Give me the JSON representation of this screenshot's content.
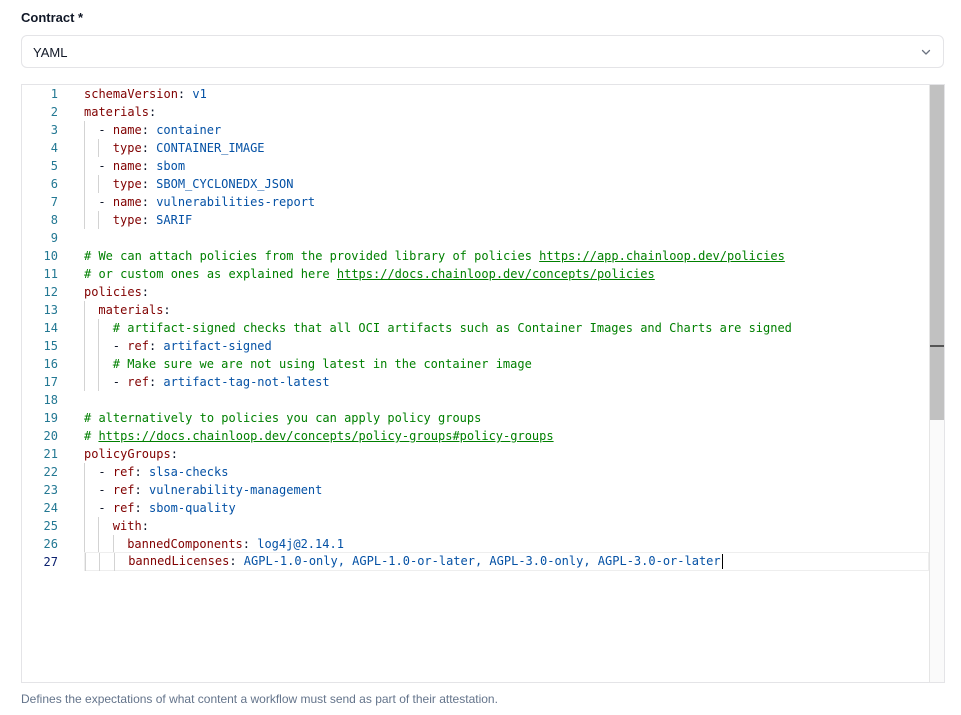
{
  "field": {
    "label": "Contract *",
    "selected": "YAML",
    "help": "Defines the expectations of what content a workflow must send as part of their attestation."
  },
  "editor": {
    "language": "yaml",
    "active_line": 27,
    "lines": [
      {
        "n": "1",
        "indent": 0,
        "tokens": [
          {
            "t": "schemaVersion",
            "c": "k"
          },
          {
            "t": ": ",
            "c": "p"
          },
          {
            "t": "v1",
            "c": "s"
          }
        ]
      },
      {
        "n": "2",
        "indent": 0,
        "tokens": [
          {
            "t": "materials",
            "c": "k"
          },
          {
            "t": ":",
            "c": "p"
          }
        ]
      },
      {
        "n": "3",
        "indent": 1,
        "tokens": [
          {
            "t": "- ",
            "c": "p"
          },
          {
            "t": "name",
            "c": "k"
          },
          {
            "t": ": ",
            "c": "p"
          },
          {
            "t": "container",
            "c": "s"
          }
        ]
      },
      {
        "n": "4",
        "indent": 2,
        "tokens": [
          {
            "t": "type",
            "c": "k"
          },
          {
            "t": ": ",
            "c": "p"
          },
          {
            "t": "CONTAINER_IMAGE",
            "c": "s"
          }
        ]
      },
      {
        "n": "5",
        "indent": 1,
        "tokens": [
          {
            "t": "- ",
            "c": "p"
          },
          {
            "t": "name",
            "c": "k"
          },
          {
            "t": ": ",
            "c": "p"
          },
          {
            "t": "sbom",
            "c": "s"
          }
        ]
      },
      {
        "n": "6",
        "indent": 2,
        "tokens": [
          {
            "t": "type",
            "c": "k"
          },
          {
            "t": ": ",
            "c": "p"
          },
          {
            "t": "SBOM_CYCLONEDX_JSON",
            "c": "s"
          }
        ]
      },
      {
        "n": "7",
        "indent": 1,
        "tokens": [
          {
            "t": "- ",
            "c": "p"
          },
          {
            "t": "name",
            "c": "k"
          },
          {
            "t": ": ",
            "c": "p"
          },
          {
            "t": "vulnerabilities-report",
            "c": "s"
          }
        ]
      },
      {
        "n": "8",
        "indent": 2,
        "tokens": [
          {
            "t": "type",
            "c": "k"
          },
          {
            "t": ": ",
            "c": "p"
          },
          {
            "t": "SARIF",
            "c": "s"
          }
        ]
      },
      {
        "n": "9",
        "indent": 0,
        "tokens": []
      },
      {
        "n": "10",
        "indent": 0,
        "tokens": [
          {
            "t": "# We can attach policies from the provided library of policies ",
            "c": "c"
          },
          {
            "t": "https://app.chainloop.dev/policies",
            "c": "u"
          }
        ]
      },
      {
        "n": "11",
        "indent": 0,
        "tokens": [
          {
            "t": "# or custom ones as explained here ",
            "c": "c"
          },
          {
            "t": "https://docs.chainloop.dev/concepts/policies",
            "c": "u"
          }
        ]
      },
      {
        "n": "12",
        "indent": 0,
        "tokens": [
          {
            "t": "policies",
            "c": "k"
          },
          {
            "t": ":",
            "c": "p"
          }
        ]
      },
      {
        "n": "13",
        "indent": 1,
        "tokens": [
          {
            "t": "materials",
            "c": "k"
          },
          {
            "t": ":",
            "c": "p"
          }
        ]
      },
      {
        "n": "14",
        "indent": 2,
        "tokens": [
          {
            "t": "# artifact-signed checks that all OCI artifacts such as Container Images and Charts are signed",
            "c": "c"
          }
        ]
      },
      {
        "n": "15",
        "indent": 2,
        "tokens": [
          {
            "t": "- ",
            "c": "p"
          },
          {
            "t": "ref",
            "c": "k"
          },
          {
            "t": ": ",
            "c": "p"
          },
          {
            "t": "artifact-signed",
            "c": "s"
          }
        ]
      },
      {
        "n": "16",
        "indent": 2,
        "tokens": [
          {
            "t": "# Make sure we are not using latest in the container image",
            "c": "c"
          }
        ]
      },
      {
        "n": "17",
        "indent": 2,
        "tokens": [
          {
            "t": "- ",
            "c": "p"
          },
          {
            "t": "ref",
            "c": "k"
          },
          {
            "t": ": ",
            "c": "p"
          },
          {
            "t": "artifact-tag-not-latest",
            "c": "s"
          }
        ]
      },
      {
        "n": "18",
        "indent": 0,
        "tokens": []
      },
      {
        "n": "19",
        "indent": 0,
        "tokens": [
          {
            "t": "# alternatively to policies you can apply policy groups",
            "c": "c"
          }
        ]
      },
      {
        "n": "20",
        "indent": 0,
        "tokens": [
          {
            "t": "# ",
            "c": "c"
          },
          {
            "t": "https://docs.chainloop.dev/concepts/policy-groups#policy-groups",
            "c": "u"
          }
        ]
      },
      {
        "n": "21",
        "indent": 0,
        "tokens": [
          {
            "t": "policyGroups",
            "c": "k"
          },
          {
            "t": ":",
            "c": "p"
          }
        ]
      },
      {
        "n": "22",
        "indent": 1,
        "tokens": [
          {
            "t": "- ",
            "c": "p"
          },
          {
            "t": "ref",
            "c": "k"
          },
          {
            "t": ": ",
            "c": "p"
          },
          {
            "t": "slsa-checks",
            "c": "s"
          }
        ]
      },
      {
        "n": "23",
        "indent": 1,
        "tokens": [
          {
            "t": "- ",
            "c": "p"
          },
          {
            "t": "ref",
            "c": "k"
          },
          {
            "t": ": ",
            "c": "p"
          },
          {
            "t": "vulnerability-management",
            "c": "s"
          }
        ]
      },
      {
        "n": "24",
        "indent": 1,
        "tokens": [
          {
            "t": "- ",
            "c": "p"
          },
          {
            "t": "ref",
            "c": "k"
          },
          {
            "t": ": ",
            "c": "p"
          },
          {
            "t": "sbom-quality",
            "c": "s"
          }
        ]
      },
      {
        "n": "25",
        "indent": 2,
        "tokens": [
          {
            "t": "with",
            "c": "k"
          },
          {
            "t": ":",
            "c": "p"
          }
        ]
      },
      {
        "n": "26",
        "indent": 3,
        "tokens": [
          {
            "t": "bannedComponents",
            "c": "k"
          },
          {
            "t": ": ",
            "c": "p"
          },
          {
            "t": "log4j@2.14.1",
            "c": "s"
          }
        ]
      },
      {
        "n": "27",
        "indent": 3,
        "tokens": [
          {
            "t": "bannedLicenses",
            "c": "k"
          },
          {
            "t": ": ",
            "c": "p"
          },
          {
            "t": "AGPL-1.0-only, AGPL-1.0-or-later, AGPL-3.0-only, AGPL-3.0-or-later",
            "c": "s"
          }
        ]
      }
    ]
  },
  "icons": {
    "dropdown": "chevron-down-icon"
  }
}
